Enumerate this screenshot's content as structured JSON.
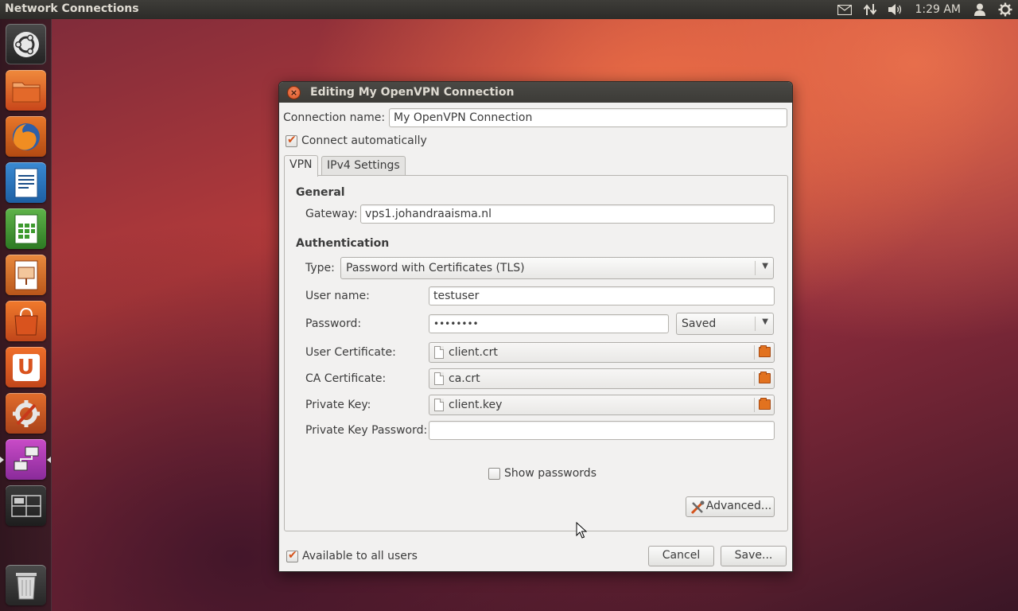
{
  "top_panel": {
    "app_title": "Network Connections",
    "clock": "1:29 AM",
    "indicators": [
      "mail-icon",
      "network-icon",
      "volume-icon",
      "user-icon",
      "session-gear-icon"
    ]
  },
  "launcher": {
    "items": [
      {
        "name": "dash-home",
        "icon": "ubuntu-logo-icon"
      },
      {
        "name": "files",
        "icon": "folder-icon"
      },
      {
        "name": "firefox",
        "icon": "firefox-icon"
      },
      {
        "name": "writer",
        "icon": "writer-icon"
      },
      {
        "name": "calc",
        "icon": "calc-icon"
      },
      {
        "name": "impress",
        "icon": "impress-icon"
      },
      {
        "name": "software-center",
        "icon": "shopping-bag-icon"
      },
      {
        "name": "ubuntu-one",
        "icon": "ubuntu-one-icon",
        "letter": "U"
      },
      {
        "name": "system-settings",
        "icon": "settings-icon"
      },
      {
        "name": "network-connections",
        "icon": "network-connections-icon"
      },
      {
        "name": "workspace-switcher",
        "icon": "workspace-icon"
      },
      {
        "name": "trash",
        "icon": "trash-icon"
      }
    ]
  },
  "dialog": {
    "title": "Editing My OpenVPN Connection",
    "connection_name_label": "Connection name:",
    "connection_name_value": "My OpenVPN Connection",
    "connect_automatically_label": "Connect automatically",
    "connect_automatically_checked": true,
    "tabs": [
      {
        "label": "VPN",
        "active": true
      },
      {
        "label": "IPv4 Settings",
        "active": false
      }
    ],
    "vpn": {
      "general_heading": "General",
      "gateway_label": "Gateway:",
      "gateway_value": "vps1.johandraaisma.nl",
      "auth_heading": "Authentication",
      "type_label": "Type:",
      "type_value": "Password with Certificates (TLS)",
      "username_label": "User name:",
      "username_value": "testuser",
      "password_label": "Password:",
      "password_value": "••••••••",
      "password_storage_value": "Saved",
      "user_cert_label": "User Certificate:",
      "user_cert_value": "client.crt",
      "ca_cert_label": "CA Certificate:",
      "ca_cert_value": "ca.crt",
      "private_key_label": "Private Key:",
      "private_key_value": "client.key",
      "private_key_password_label": "Private Key Password:",
      "private_key_password_value": "",
      "show_passwords_label": "Show passwords",
      "show_passwords_checked": false,
      "advanced_button_label": "Advanced..."
    },
    "available_all_users_label": "Available to all users",
    "available_all_users_checked": true,
    "cancel_button_label": "Cancel",
    "save_button_label": "Save..."
  },
  "colors": {
    "accent_orange": "#dd4814",
    "panel_dark": "#3c3b37",
    "dialog_bg": "#f2f1f0"
  }
}
